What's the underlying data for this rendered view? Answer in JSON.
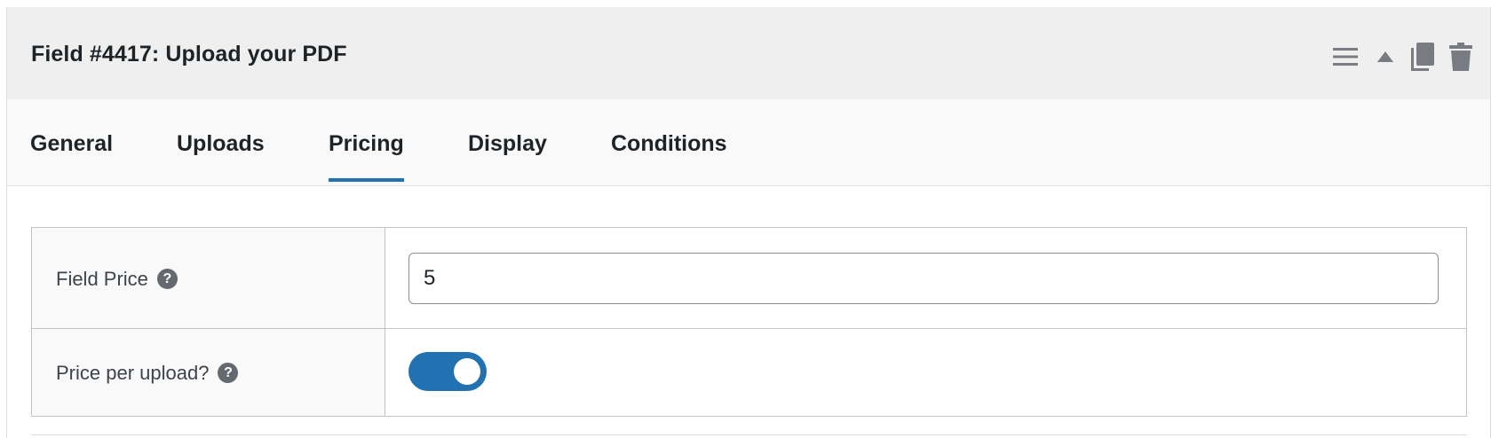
{
  "header": {
    "title": "Field #4417: Upload your PDF",
    "icons": [
      "menu-icon",
      "arrow-up-icon",
      "duplicate-icon",
      "trash-icon"
    ]
  },
  "tabs": [
    {
      "label": "General",
      "active": false
    },
    {
      "label": "Uploads",
      "active": false
    },
    {
      "label": "Pricing",
      "active": true
    },
    {
      "label": "Display",
      "active": false
    },
    {
      "label": "Conditions",
      "active": false
    }
  ],
  "settings": {
    "field_price": {
      "label": "Field Price",
      "help": "?",
      "value": "5"
    },
    "price_per_upload": {
      "label": "Price per upload?",
      "help": "?",
      "enabled": true
    }
  },
  "colors": {
    "accent": "#2271b1",
    "header_bg": "#efefef",
    "tabs_bg": "#f9f9f9",
    "help_icon": "#646970",
    "header_icon": "#787c82"
  }
}
